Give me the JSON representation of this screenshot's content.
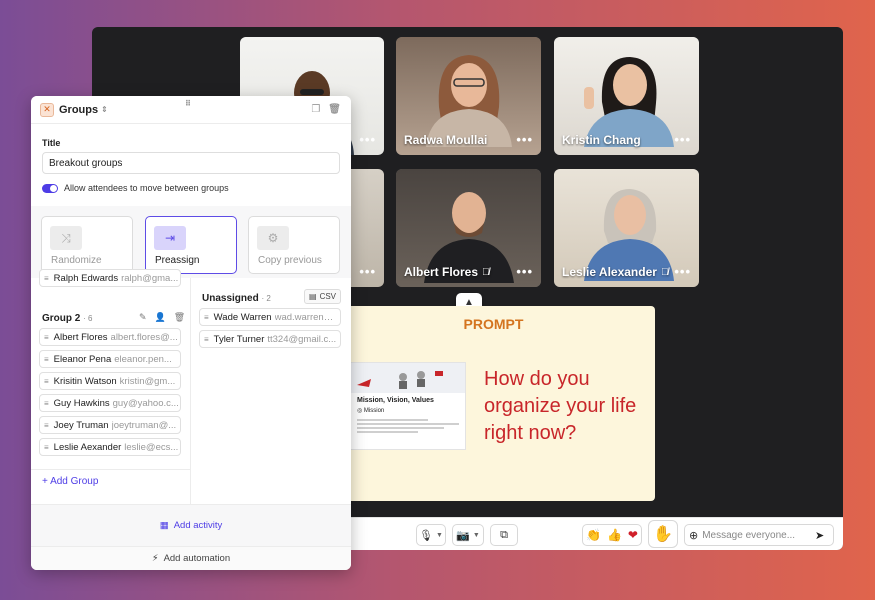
{
  "participants": [
    {
      "name": "",
      "muted": false
    },
    {
      "name": "Radwa Moullai",
      "muted": false
    },
    {
      "name": "Kristin Chang",
      "muted": false
    },
    {
      "name": "",
      "muted": false
    },
    {
      "name": "Albert Flores",
      "muted": true
    },
    {
      "name": "Leslie Alexander",
      "muted": true
    }
  ],
  "tile_more": "•••",
  "prompt": {
    "heading": "PROMPT",
    "doc_title": "Mission, Vision, Values",
    "doc_section": "Mission",
    "question": "How do you organize your life right now?"
  },
  "toolbar": {
    "message_placeholder": "Message everyone...",
    "reactions": [
      "👏",
      "👍",
      "❤"
    ]
  },
  "panel": {
    "header_title": "Groups",
    "title_label": "Title",
    "title_value": "Breakout groups",
    "allow_move_label": "Allow attendees to move between groups",
    "allow_move_on": true,
    "modes": [
      {
        "label": "Randomize",
        "active": false
      },
      {
        "label": "Preassign",
        "active": true
      },
      {
        "label": "Copy previous",
        "active": false
      }
    ],
    "group1_partial": {
      "name": "Ralph Edwards",
      "email": "ralph@gma..."
    },
    "group2": {
      "title": "Group 2",
      "count": "· 6",
      "members": [
        {
          "name": "Albert Flores",
          "email": "albert.flores@..."
        },
        {
          "name": "Eleanor Pena",
          "email": "eleanor.pen..."
        },
        {
          "name": "Krisitin Watson",
          "email": "kristin@gm..."
        },
        {
          "name": "Guy Hawkins",
          "email": "guy@yahoo.c..."
        },
        {
          "name": "Joey Truman",
          "email": "joeytruman@..."
        },
        {
          "name": "Leslie Aexander",
          "email": "leslie@ecs..."
        }
      ]
    },
    "unassigned": {
      "title": "Unassigned",
      "count": "· 2",
      "csv_label": "CSV",
      "members": [
        {
          "name": "Wade Warren",
          "email": "wad.warren@..."
        },
        {
          "name": "Tyler Turner",
          "email": "tt324@gmail.c..."
        }
      ]
    },
    "add_group": "+ Add Group",
    "add_activity": "Add activity",
    "add_automation": "Add automation"
  }
}
